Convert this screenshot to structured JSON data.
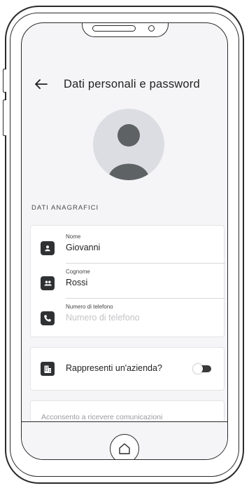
{
  "header": {
    "title": "Dati personali e password",
    "back_icon": "arrow-left-icon"
  },
  "profile": {
    "avatar_icon": "user-silhouette-icon"
  },
  "section": {
    "label": "DATI ANAGRAFICI"
  },
  "fields": [
    {
      "icon": "id-card-icon",
      "label": "Nome",
      "value": "Giovanni"
    },
    {
      "icon": "contacts-icon",
      "label": "Cognome",
      "value": "Rossi"
    },
    {
      "icon": "phone-icon",
      "label": "Numero di telefono",
      "value": "",
      "placeholder": "Numero di telefono"
    }
  ],
  "company": {
    "icon": "building-icon",
    "question": "Rappresenti un'azienda?",
    "toggle_on": false
  },
  "consent": {
    "text": "Acconsento a ricevere comunicazioni"
  },
  "device": {
    "home_icon": "home-outline-icon"
  },
  "colors": {
    "background": "#f5f5f7",
    "card": "#ffffff",
    "icon_fill": "#2f3133",
    "avatar_bg": "#dcdde2",
    "avatar_fg": "#5f6265",
    "placeholder": "#c4c4c8"
  }
}
